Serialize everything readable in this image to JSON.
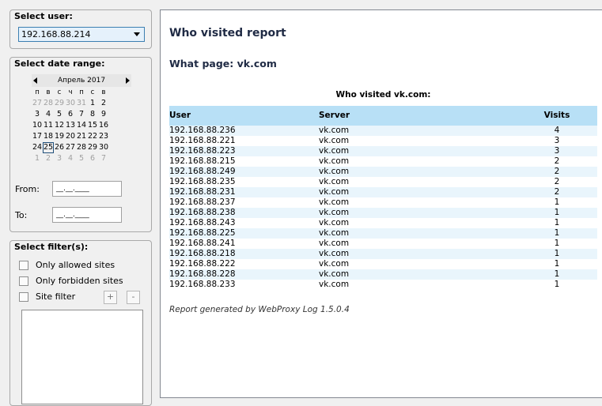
{
  "user_group": {
    "title": "Select user:",
    "selected": "192.168.88.214"
  },
  "date_group": {
    "title": "Select date range:",
    "month": "Апрель 2017",
    "weekdays": [
      "п",
      "в",
      "с",
      "ч",
      "п",
      "с",
      "в"
    ],
    "weeks": [
      [
        {
          "d": "27",
          "g": true
        },
        {
          "d": "28",
          "g": true
        },
        {
          "d": "29",
          "g": true
        },
        {
          "d": "30",
          "g": true
        },
        {
          "d": "31",
          "g": true
        },
        {
          "d": "1"
        },
        {
          "d": "2"
        }
      ],
      [
        {
          "d": "3"
        },
        {
          "d": "4"
        },
        {
          "d": "5"
        },
        {
          "d": "6"
        },
        {
          "d": "7"
        },
        {
          "d": "8"
        },
        {
          "d": "9"
        }
      ],
      [
        {
          "d": "10"
        },
        {
          "d": "11"
        },
        {
          "d": "12"
        },
        {
          "d": "13"
        },
        {
          "d": "14"
        },
        {
          "d": "15"
        },
        {
          "d": "16"
        }
      ],
      [
        {
          "d": "17"
        },
        {
          "d": "18"
        },
        {
          "d": "19"
        },
        {
          "d": "20"
        },
        {
          "d": "21"
        },
        {
          "d": "22"
        },
        {
          "d": "23"
        }
      ],
      [
        {
          "d": "24"
        },
        {
          "d": "25",
          "today": true
        },
        {
          "d": "26"
        },
        {
          "d": "27"
        },
        {
          "d": "28"
        },
        {
          "d": "29"
        },
        {
          "d": "30"
        }
      ],
      [
        {
          "d": "1",
          "g": true
        },
        {
          "d": "2",
          "g": true
        },
        {
          "d": "3",
          "g": true
        },
        {
          "d": "4",
          "g": true
        },
        {
          "d": "5",
          "g": true
        },
        {
          "d": "6",
          "g": true
        },
        {
          "d": "7",
          "g": true
        }
      ]
    ],
    "from_label": "From:",
    "from_value": "__.__.____",
    "to_label": "To:",
    "to_value": "__.__.____"
  },
  "filter_group": {
    "title": "Select filter(s):",
    "only_allowed": "Only allowed sites",
    "only_forbidden": "Only forbidden sites",
    "site_filter": "Site filter",
    "add": "+",
    "remove": "-"
  },
  "report": {
    "title": "Who visited report",
    "subtitle": "What page: vk.com",
    "table_caption": "Who visited vk.com:",
    "columns": [
      "User",
      "Server",
      "Visits"
    ],
    "rows": [
      [
        "192.168.88.236",
        "vk.com",
        "4"
      ],
      [
        "192.168.88.221",
        "vk.com",
        "3"
      ],
      [
        "192.168.88.223",
        "vk.com",
        "3"
      ],
      [
        "192.168.88.215",
        "vk.com",
        "2"
      ],
      [
        "192.168.88.249",
        "vk.com",
        "2"
      ],
      [
        "192.168.88.235",
        "vk.com",
        "2"
      ],
      [
        "192.168.88.231",
        "vk.com",
        "2"
      ],
      [
        "192.168.88.237",
        "vk.com",
        "1"
      ],
      [
        "192.168.88.238",
        "vk.com",
        "1"
      ],
      [
        "192.168.88.243",
        "vk.com",
        "1"
      ],
      [
        "192.168.88.225",
        "vk.com",
        "1"
      ],
      [
        "192.168.88.241",
        "vk.com",
        "1"
      ],
      [
        "192.168.88.218",
        "vk.com",
        "1"
      ],
      [
        "192.168.88.222",
        "vk.com",
        "1"
      ],
      [
        "192.168.88.228",
        "vk.com",
        "1"
      ],
      [
        "192.168.88.233",
        "vk.com",
        "1"
      ]
    ],
    "footer": "Report generated by WebProxy Log 1.5.0.4"
  }
}
